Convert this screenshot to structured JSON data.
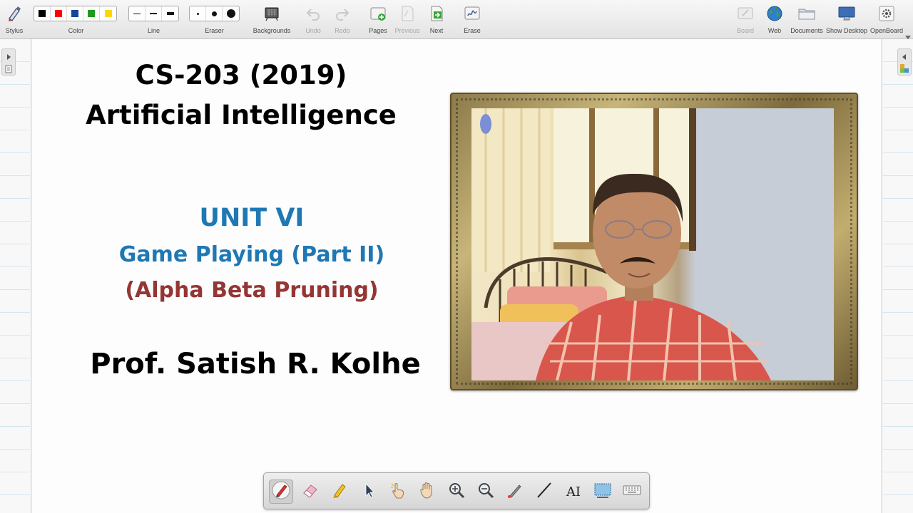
{
  "toolbar": {
    "stylus_label": "Stylus",
    "color_label": "Color",
    "line_label": "Line",
    "eraser_label": "Eraser",
    "backgrounds_label": "Backgrounds",
    "undo_label": "Undo",
    "redo_label": "Redo",
    "pages_label": "Pages",
    "previous_label": "Previous",
    "next_label": "Next",
    "erase_label": "Erase",
    "board_label": "Board",
    "web_label": "Web",
    "documents_label": "Documents",
    "show_desktop_label": "Show Desktop",
    "openboard_label": "OpenBoard",
    "colors": [
      "#000000",
      "#ff0000",
      "#1446a0",
      "#1f9a1f",
      "#ffd700"
    ]
  },
  "slide": {
    "course_code": "CS-203 (2019)",
    "course_name": "Artificial Intelligence",
    "unit": "UNIT VI",
    "topic": "Game Playing (Part II)",
    "subtopic": "(Alpha Beta Pruning)",
    "presenter": "Prof. Satish R. Kolhe",
    "colors": {
      "heading": "#000000",
      "unit": "#1f78b4",
      "subtopic": "#943634"
    }
  },
  "palette": {
    "tools": [
      "pen-icon",
      "eraser-icon",
      "highlighter-icon",
      "selector-icon",
      "pointer-hand-icon",
      "pan-hand-icon",
      "zoom-in-icon",
      "zoom-out-icon",
      "laser-pointer-icon",
      "line-icon",
      "text-icon",
      "capture-icon",
      "keyboard-icon"
    ],
    "text_tool_glyph": "AI"
  }
}
